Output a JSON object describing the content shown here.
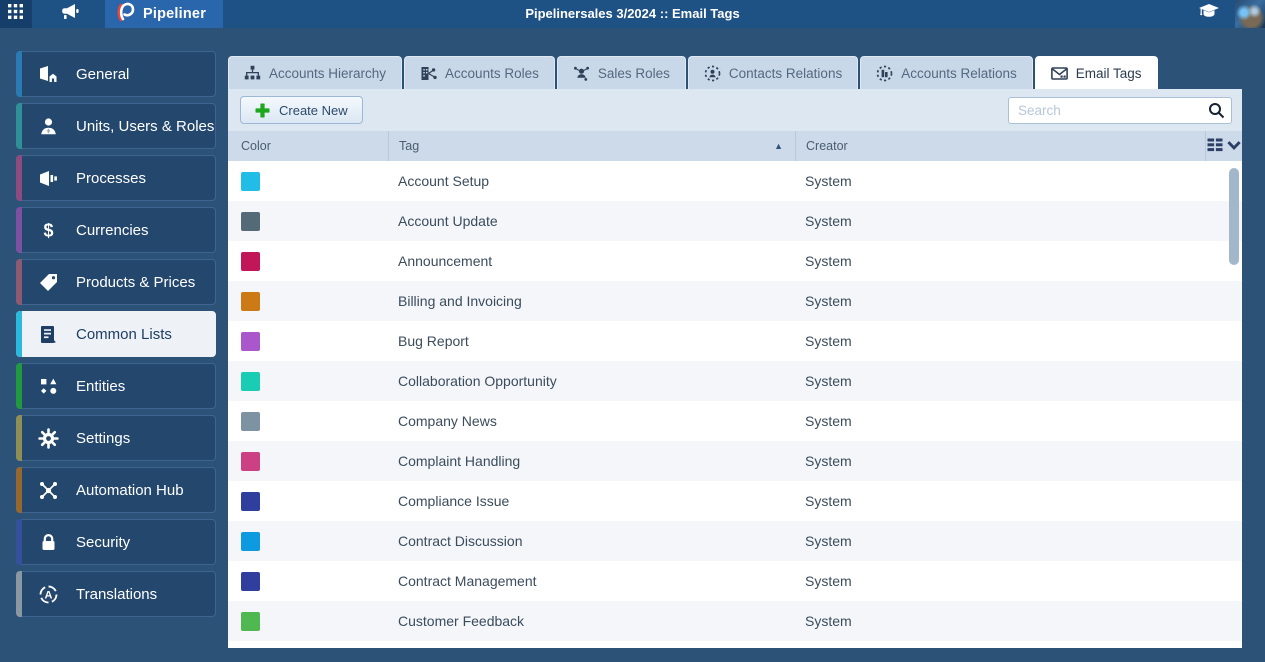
{
  "topbar": {
    "brand": "Pipeliner",
    "title": "Pipelinersales 3/2024 :: Email Tags",
    "icons": {
      "apps": "apps-grid-icon",
      "announce": "megaphone-icon",
      "logo": "pipeliner-logo",
      "academy": "graduation-cap-icon",
      "avatar": "user-avatar"
    }
  },
  "sidebar": {
    "items": [
      {
        "label": "General",
        "icon": "general-icon",
        "accent": "#2b7ab4",
        "selected": false
      },
      {
        "label": "Units, Users & Roles",
        "icon": "users-icon",
        "accent": "#2f9097",
        "selected": false
      },
      {
        "label": "Processes",
        "icon": "processes-icon",
        "accent": "#8f4a80",
        "selected": false
      },
      {
        "label": "Currencies",
        "icon": "currencies-icon",
        "accent": "#7d50a1",
        "selected": false
      },
      {
        "label": "Products & Prices",
        "icon": "products-icon",
        "accent": "#8d5a72",
        "selected": false
      },
      {
        "label": "Common Lists",
        "icon": "common-lists-icon",
        "accent": "#2bb9dd",
        "selected": true
      },
      {
        "label": "Entities",
        "icon": "entities-icon",
        "accent": "#21993f",
        "selected": false
      },
      {
        "label": "Settings",
        "icon": "settings-icon",
        "accent": "#8f8f55",
        "selected": false
      },
      {
        "label": "Automation Hub",
        "icon": "automation-icon",
        "accent": "#97682e",
        "selected": false
      },
      {
        "label": "Security",
        "icon": "security-icon",
        "accent": "#35519e",
        "selected": false
      },
      {
        "label": "Translations",
        "icon": "translations-icon",
        "accent": "#8b97a3",
        "selected": false
      }
    ]
  },
  "tabs": [
    {
      "label": "Accounts Hierarchy",
      "icon": "hierarchy-icon",
      "active": false
    },
    {
      "label": "Accounts Roles",
      "icon": "accounts-roles-icon",
      "active": false
    },
    {
      "label": "Sales Roles",
      "icon": "sales-roles-icon",
      "active": false
    },
    {
      "label": "Contacts Relations",
      "icon": "contacts-relations-icon",
      "active": false
    },
    {
      "label": "Accounts Relations",
      "icon": "accounts-relations-icon",
      "active": false
    },
    {
      "label": "Email Tags",
      "icon": "email-tags-icon",
      "active": true
    }
  ],
  "toolbar": {
    "create_label": "Create New",
    "search_placeholder": "Search"
  },
  "table": {
    "columns": [
      "Color",
      "Tag",
      "Creator"
    ],
    "sorted_column": "Tag",
    "sort_direction": "asc",
    "sort_arrow": "▲",
    "rows": [
      {
        "color": "#22bde6",
        "tag": "Account Setup",
        "creator": "System"
      },
      {
        "color": "#546a77",
        "tag": "Account Update",
        "creator": "System"
      },
      {
        "color": "#c11758",
        "tag": "Announcement",
        "creator": "System"
      },
      {
        "color": "#cb7a15",
        "tag": "Billing and Invoicing",
        "creator": "System"
      },
      {
        "color": "#a957cb",
        "tag": "Bug Report",
        "creator": "System"
      },
      {
        "color": "#19ccb3",
        "tag": "Collaboration Opportunity",
        "creator": "System"
      },
      {
        "color": "#7e93a1",
        "tag": "Company News",
        "creator": "System"
      },
      {
        "color": "#cb4183",
        "tag": "Complaint Handling",
        "creator": "System"
      },
      {
        "color": "#2f3f9e",
        "tag": "Compliance Issue",
        "creator": "System"
      },
      {
        "color": "#0e9ae0",
        "tag": "Contract Discussion",
        "creator": "System"
      },
      {
        "color": "#303f9e",
        "tag": "Contract Management",
        "creator": "System"
      },
      {
        "color": "#4fb850",
        "tag": "Customer Feedback",
        "creator": "System"
      }
    ]
  }
}
